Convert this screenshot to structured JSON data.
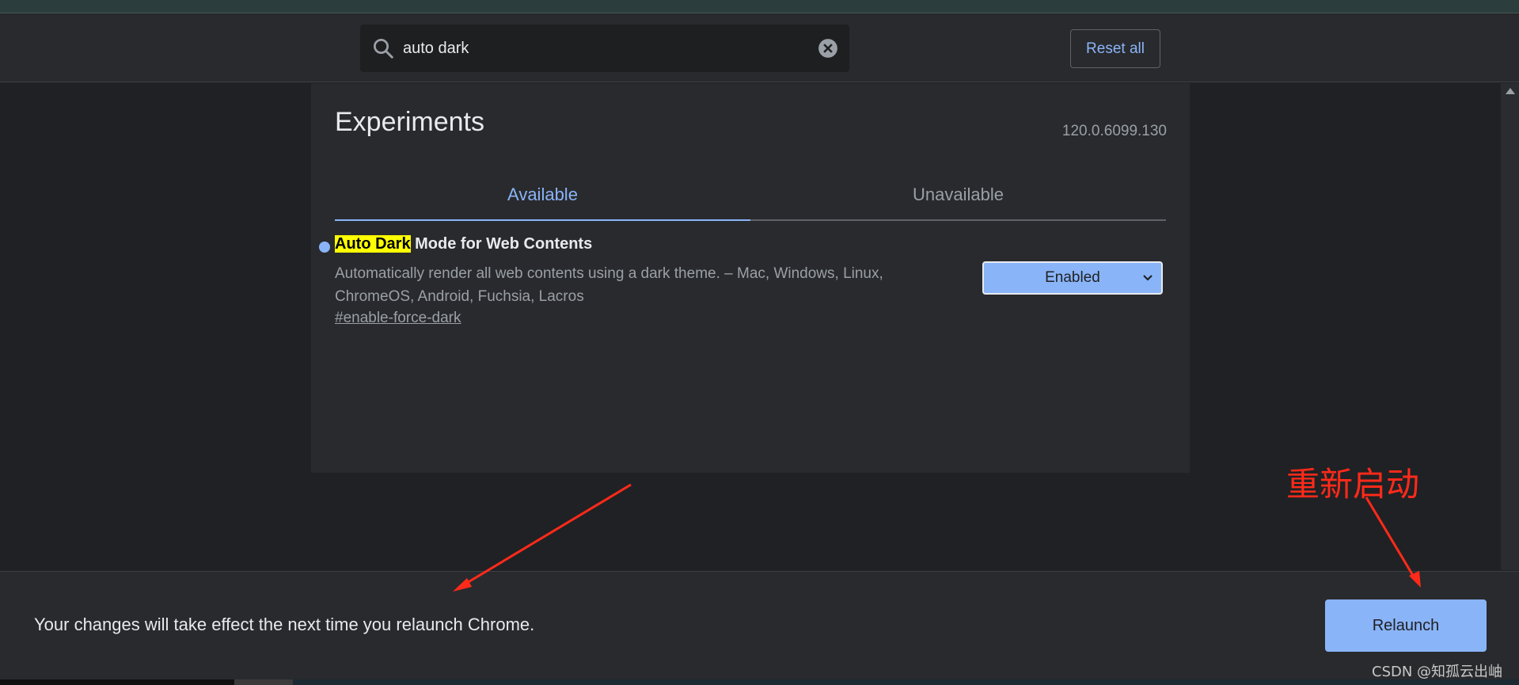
{
  "header": {
    "search": {
      "value": "auto dark",
      "placeholder": "Search flags"
    },
    "reset_label": "Reset all"
  },
  "main": {
    "title": "Experiments",
    "version": "120.0.6099.130",
    "tabs": [
      {
        "label": "Available",
        "active": true
      },
      {
        "label": "Unavailable",
        "active": false
      }
    ],
    "experiment": {
      "title_highlight": "Auto Dark",
      "title_rest": " Mode for Web Contents",
      "description": "Automatically render all web contents using a dark theme. – Mac, Windows, Linux, ChromeOS, Android, Fuchsia, Lacros",
      "link": "#enable-force-dark",
      "select_value": "Enabled"
    }
  },
  "bottom": {
    "message": "Your changes will take effect the next time you relaunch Chrome.",
    "relaunch_label": "Relaunch"
  },
  "annotation": {
    "text": "重新启动",
    "color": "#ff2a1a"
  },
  "watermark": "CSDN @知孤云出岫",
  "colors": {
    "accent": "#8ab4f8",
    "background": "#202124",
    "card": "#292a2d",
    "highlight": "#ffff00"
  }
}
